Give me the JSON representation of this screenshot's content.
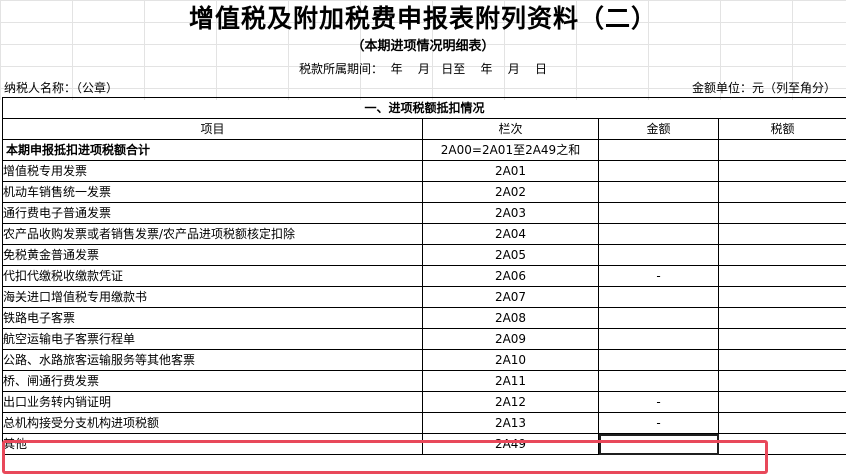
{
  "header": {
    "title": "增值税及附加税费申报表附列资料（二）",
    "subtitle": "（本期进项情况明细表）",
    "period": "税款所属期间：  年    月   日至    年    月    日",
    "taxpayer": "纳税人名称：（公章）",
    "unit": "金额单位：元（列至角分）"
  },
  "table": {
    "section_title": "一、进项税额抵扣情况",
    "columns": [
      "项目",
      "栏次",
      "金额",
      "税额"
    ],
    "rows": [
      {
        "item": "本期申报抵扣进项税额合计",
        "code": "2A00=2A01至2A49之和",
        "amount": "",
        "tax": ""
      },
      {
        "item": "增值税专用发票",
        "code": "2A01",
        "amount": "",
        "tax": ""
      },
      {
        "item": "机动车销售统一发票",
        "code": "2A02",
        "amount": "",
        "tax": ""
      },
      {
        "item": "通行费电子普通发票",
        "code": "2A03",
        "amount": "",
        "tax": ""
      },
      {
        "item": "农产品收购发票或者销售发票/农产品进项税额核定扣除",
        "code": "2A04",
        "amount": "",
        "tax": ""
      },
      {
        "item": "免税黄金普通发票",
        "code": "2A05",
        "amount": "",
        "tax": ""
      },
      {
        "item": "代扣代缴税收缴款凭证",
        "code": "2A06",
        "amount": "-",
        "tax": ""
      },
      {
        "item": "海关进口增值税专用缴款书",
        "code": "2A07",
        "amount": "",
        "tax": ""
      },
      {
        "item": "铁路电子客票",
        "code": "2A08",
        "amount": "",
        "tax": ""
      },
      {
        "item": "航空运输电子客票行程单",
        "code": "2A09",
        "amount": "",
        "tax": ""
      },
      {
        "item": "公路、水路旅客运输服务等其他客票",
        "code": "2A10",
        "amount": "",
        "tax": ""
      },
      {
        "item": "桥、闸通行费发票",
        "code": "2A11",
        "amount": "",
        "tax": ""
      },
      {
        "item": "出口业务转内销证明",
        "code": "2A12",
        "amount": "-",
        "tax": ""
      },
      {
        "item": "总机构接受分支机构进项税额",
        "code": "2A13",
        "amount": "-",
        "tax": ""
      },
      {
        "item": "其他",
        "code": "2A49",
        "amount": "",
        "tax": ""
      }
    ]
  }
}
